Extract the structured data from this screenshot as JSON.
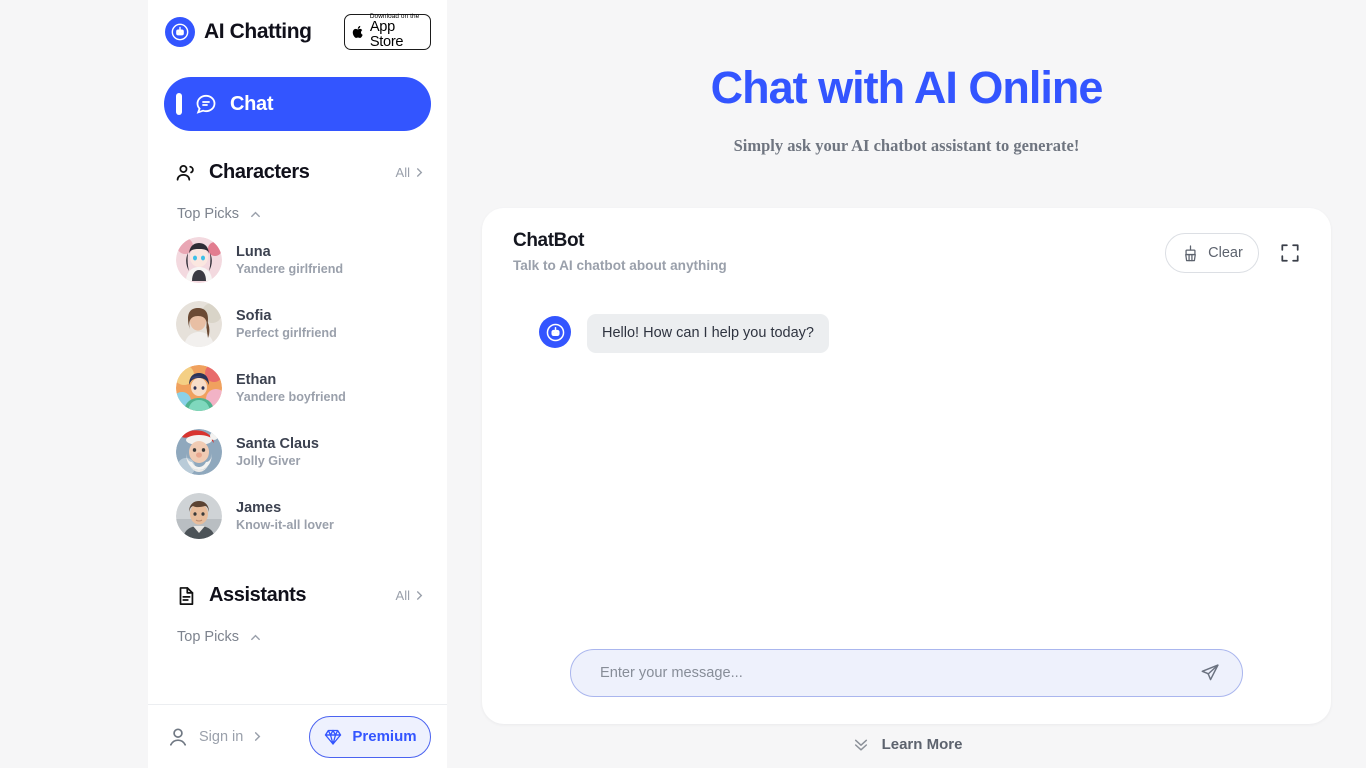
{
  "brand": {
    "name": "AI Chatting",
    "logo_icon": "chatbot-avatar-icon",
    "appstore": {
      "small_line": "Download on the",
      "big_line": "App Store",
      "icon": "apple-icon"
    }
  },
  "sidebar": {
    "nav": {
      "chat_label": "Chat",
      "chat_icon": "chat-bubble-icon"
    },
    "characters": {
      "title": "Characters",
      "icon": "people-icon",
      "all_label": "All",
      "all_icon": "chevron-right-icon",
      "subhead_label": "Top Picks",
      "subhead_icon": "chevron-up-icon",
      "items": [
        {
          "name": "Luna",
          "desc": "Yandere girlfriend",
          "avatar": "anime-girl-dark-hair"
        },
        {
          "name": "Sofia",
          "desc": "Perfect girlfriend",
          "avatar": "woman-brown-hair"
        },
        {
          "name": "Ethan",
          "desc": "Yandere boyfriend",
          "avatar": "anime-boy-colorful"
        },
        {
          "name": "Santa Claus",
          "desc": "Jolly Giver",
          "avatar": "santa-claus"
        },
        {
          "name": "James",
          "desc": "Know-it-all lover",
          "avatar": "man-short-hair"
        }
      ]
    },
    "assistants": {
      "title": "Assistants",
      "icon": "document-icon",
      "all_label": "All",
      "all_icon": "chevron-right-icon",
      "subhead_label": "Top Picks",
      "subhead_icon": "chevron-up-icon"
    },
    "footer": {
      "signin_label": "Sign in",
      "signin_icon": "user-icon",
      "signin_chevron": "chevron-right-icon",
      "premium_label": "Premium",
      "premium_icon": "diamond-icon"
    }
  },
  "main": {
    "hero_title": "Chat with AI Online",
    "hero_subtitle": "Simply ask your AI chatbot assistant to generate!",
    "card": {
      "title": "ChatBot",
      "subtitle": "Talk to AI chatbot about anything",
      "clear_label": "Clear",
      "clear_icon": "broom-icon",
      "fullscreen_icon": "fullscreen-icon",
      "messages": [
        {
          "role": "bot",
          "text": "Hello! How can I help you today?",
          "avatar_icon": "chatbot-avatar-icon"
        }
      ],
      "composer": {
        "placeholder": "Enter your message...",
        "value": "",
        "send_icon": "send-paper-plane-icon"
      }
    },
    "footer": {
      "learn_more_label": "Learn More",
      "learn_more_icon": "double-chevron-down-icon"
    }
  },
  "colors": {
    "accent_blue": "#3355ff",
    "page_bg": "#f6f6f7",
    "card_bg": "#ffffff",
    "bubble_bg": "#eceef0",
    "composer_bg": "#eef1fc",
    "muted_text": "#9aa0ab"
  }
}
